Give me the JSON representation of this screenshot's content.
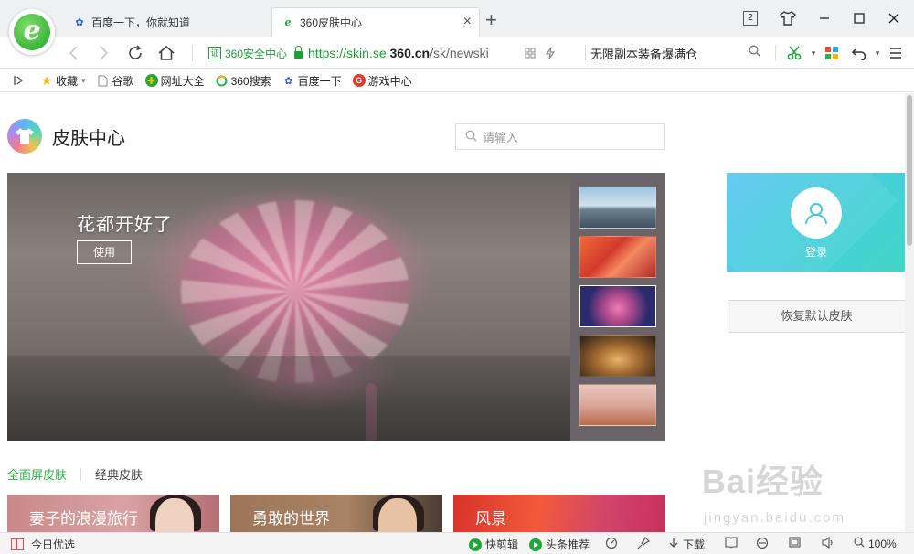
{
  "tabs": [
    {
      "label": "百度一下，你就知道"
    },
    {
      "label": "360皮肤中心"
    }
  ],
  "window": {
    "tab_count": "2"
  },
  "nav": {
    "cert_label": "证",
    "cert_text": "360安全中心",
    "url_scheme": "https://skin.se.",
    "url_domain": "360.cn",
    "url_rest": "/sk/newski",
    "search_text": "无限副本装备爆满仓"
  },
  "bookmarks": [
    {
      "label": "收藏"
    },
    {
      "label": "谷歌"
    },
    {
      "label": "网址大全"
    },
    {
      "label": "360搜索"
    },
    {
      "label": "百度一下"
    },
    {
      "label": "游戏中心"
    }
  ],
  "page": {
    "title": "皮肤中心",
    "search_placeholder": "请输入",
    "hero": {
      "title": "花都开好了",
      "use_label": "使用"
    },
    "login_label": "登录",
    "restore_label": "恢复默认皮肤",
    "categories": [
      {
        "label": "全面屏皮肤"
      },
      {
        "label": "经典皮肤"
      }
    ],
    "cards": [
      {
        "title": "妻子的浪漫旅行"
      },
      {
        "title": "勇敢的世界"
      },
      {
        "title": "风景"
      }
    ]
  },
  "status": {
    "left": "今日优选",
    "clip": "快剪辑",
    "news": "头条推荐",
    "download": "下载",
    "zoom": "100%"
  },
  "watermark": {
    "main": "Bai经验",
    "sub": "jingyan.baidu.com"
  },
  "colors": {
    "accent_green": "#2bb14a",
    "url_green": "#1aa033",
    "login_card": "#45d0d8"
  }
}
